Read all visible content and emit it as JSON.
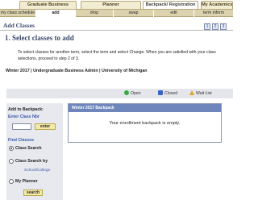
{
  "top_tabs": [
    {
      "label": "Graduate Business",
      "active": false
    },
    {
      "label": "Planner",
      "active": false
    },
    {
      "label": "Backpack/ Registration",
      "active": true
    },
    {
      "label": "My Academics",
      "active": false
    }
  ],
  "subnav": [
    {
      "label": "my class schedule",
      "active": false
    },
    {
      "label": "add",
      "active": true
    },
    {
      "label": "drop",
      "active": false
    },
    {
      "label": "swap",
      "active": false
    },
    {
      "label": "edit",
      "active": false
    },
    {
      "label": "term inform",
      "active": false
    }
  ],
  "page": {
    "title": "Add Classes",
    "step_heading": "1.  Select classes to add",
    "instructions": "To select classes for another term, select the term and select Change.  When you are satisfied with your class selections, proceed to step 2 of 3.",
    "term_line": "Winter 2017 | Undergraduate Business Admin | University of Michigan"
  },
  "header_icons": [
    "1",
    "2",
    "3"
  ],
  "legend": [
    {
      "label": "Open",
      "color": "#3aa845",
      "icon": "open-circle-icon"
    },
    {
      "label": "Closed",
      "color": "#3b63c4",
      "icon": "closed-square-icon"
    },
    {
      "label": "Wait List",
      "color": "#e5a51e",
      "icon": "wait-list-triangle-icon"
    }
  ],
  "left_panel": {
    "add_label": "Add to Backpack:",
    "class_nbr_label": "Enter Class Nbr",
    "class_nbr_value": "",
    "enter_button": "enter",
    "find_classes_label": "Find Classes",
    "options": [
      {
        "label": "Class Search",
        "checked": true
      },
      {
        "label": "Class Search by",
        "checked": false
      },
      {
        "label": "My Planner",
        "checked": false
      }
    ],
    "school_college": "School/College",
    "search_button": "search"
  },
  "backpack": {
    "header": "Winter 2017 Backpack",
    "message": "Your enrollment backpack is empty."
  },
  "colors": {
    "accent_blue": "#6f86bd",
    "tab_beige": "#f2ecd2",
    "link_blue": "#3b5aa8"
  }
}
